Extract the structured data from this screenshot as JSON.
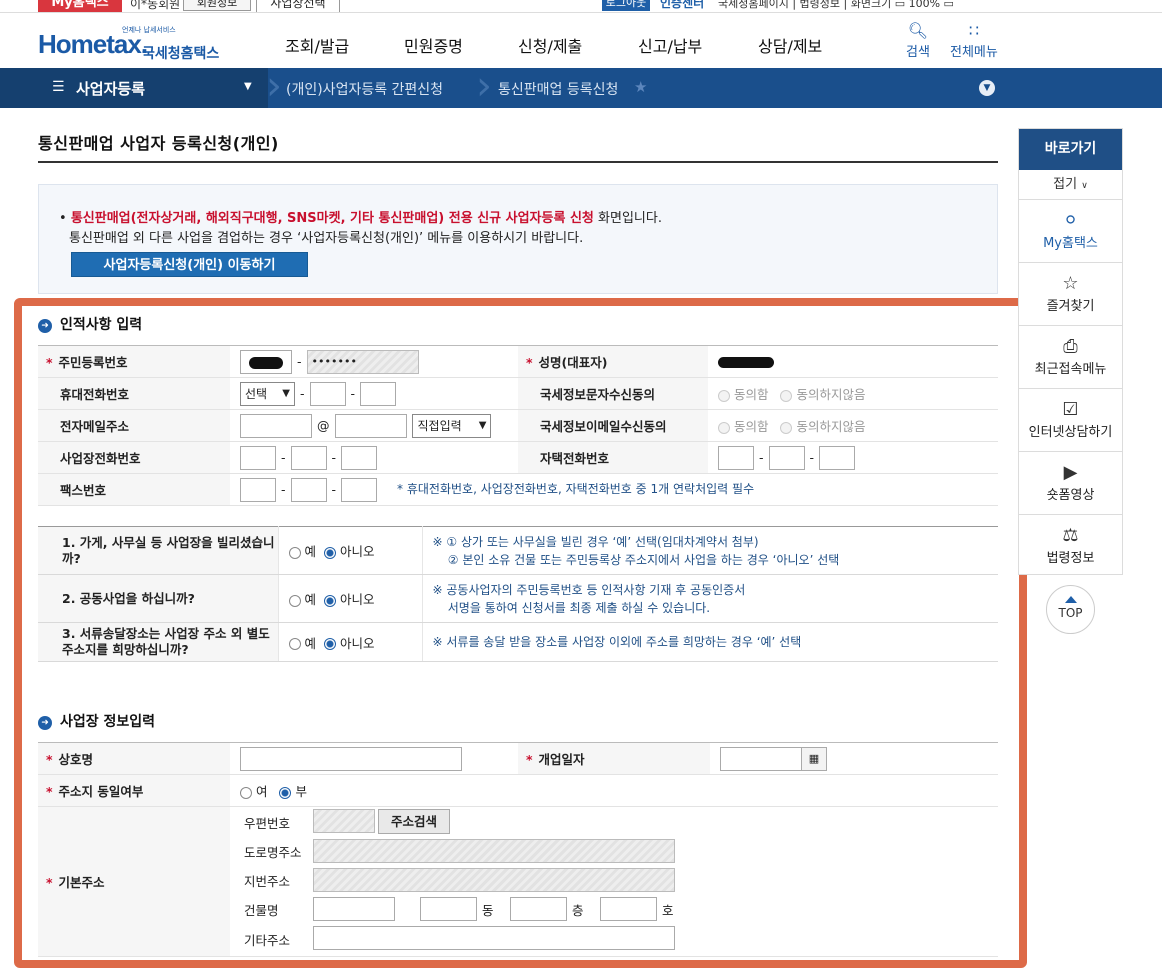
{
  "util": {
    "myhome": "My홈택스",
    "user": "이*동회원",
    "userinfo": "회원정보",
    "bizreg": "사업장선택",
    "logout": "로그아웃",
    "cert": "인증센터",
    "links": "국세청홈페이지 | 법령정보 | 화면크기 ▭ 100% ▭"
  },
  "header": {
    "logo_main": "Hometax.",
    "logo_sub": "언제나 납세서비스",
    "logo_kr": "국세청홈택스",
    "nav": [
      "조회/발급",
      "민원증명",
      "신청/제출",
      "신고/납부",
      "상담/제보"
    ],
    "search_label": "검색",
    "allmenu_label": "전체메뉴"
  },
  "breadcrumb": {
    "menu": "사업자등록",
    "items": [
      "(개인)사업자등록 간편신청",
      "통신판매업 등록신청"
    ]
  },
  "page": {
    "title": "통신판매업 사업자 등록신청(개인)"
  },
  "notice": {
    "line1_red": "통신판매업(전자상거래, 해외직구대행, SNS마켓, 기타 통신판매업) 전용 신규 사업자등록 신청",
    "line1_rest": " 화면입니다.",
    "line2": "통신판매업 외 다른 사업을 겸업하는 경우 ‘사업자등록신청(개인)’ 메뉴를 이용하시기 바랍니다.",
    "button": "사업자등록신청(개인) 이동하기"
  },
  "personal": {
    "section_title": "인적사항 입력",
    "rrn_label": "주민등록번호",
    "rrn_back": "•••••••",
    "name_label": "성명(대표자)",
    "mobile_label": "휴대전화번호",
    "mobile_select": "선택",
    "sms_label": "국세정보문자수신동의",
    "agree": "동의함",
    "disagree": "동의하지않음",
    "email_label": "전자메일주소",
    "email_domain_select": "직접입력",
    "email_consent_label": "국세정보이메일수신동의",
    "bizphone_label": "사업장전화번호",
    "homephone_label": "자택전화번호",
    "fax_label": "팩스번호",
    "contact_note": "* 휴대전화번호, 사업장전화번호, 자택전화번호 중 1개 연락처입력 필수",
    "at": "@"
  },
  "questions": [
    {
      "label": "1. 가게, 사무실 등 사업장을 빌리셨습니까?",
      "note": "※ ① 상가 또는 사무실을 빌린 경우 ‘예’ 선택(임대차계약서 첨부)\n    ② 본인 소유 건물 또는 주민등록상 주소지에서 사업을 하는 경우 ‘아니오’ 선택"
    },
    {
      "label": "2. 공동사업을 하십니까?",
      "note": "※ 공동사업자의 주민등록번호 등 인적사항 기재 후 공동인증서\n    서명을 통하여 신청서를 최종 제출 하실 수 있습니다."
    },
    {
      "label": "3. 서류송달장소는 사업장 주소 외 별도 주소지를 희망하십니까?",
      "note": "※ 서류를 송달 받을 장소를 사업장 이외에 주소를 희망하는 경우 ‘예’ 선택"
    }
  ],
  "yes": "예",
  "no": "아니오",
  "business": {
    "section_title": "사업장 정보입력",
    "trade_name_label": "상호명",
    "open_date_label": "개업일자",
    "same_addr_label": "주소지 동일여부",
    "same_yes": "여",
    "same_no": "부",
    "addr_label": "기본주소",
    "zip_label": "우편번호",
    "addr_search_btn": "주소검색",
    "road_label": "도로명주소",
    "jibun_label": "지번주소",
    "building_label": "건물명",
    "dong": "동",
    "floor": "층",
    "ho": "호",
    "etc_label": "기타주소"
  },
  "quick": {
    "title": "바로가기",
    "fold": "접기",
    "items": [
      "My홈택스",
      "즐겨찾기",
      "최근접속메뉴",
      "인터넷상담하기",
      "숏폼영상",
      "법령정보"
    ],
    "top": "TOP"
  },
  "colors": {
    "brand": "#1b5aa6",
    "nav_bar": "#1a4f8c",
    "highlight": "#dd6a48",
    "required": "#c8102e"
  }
}
